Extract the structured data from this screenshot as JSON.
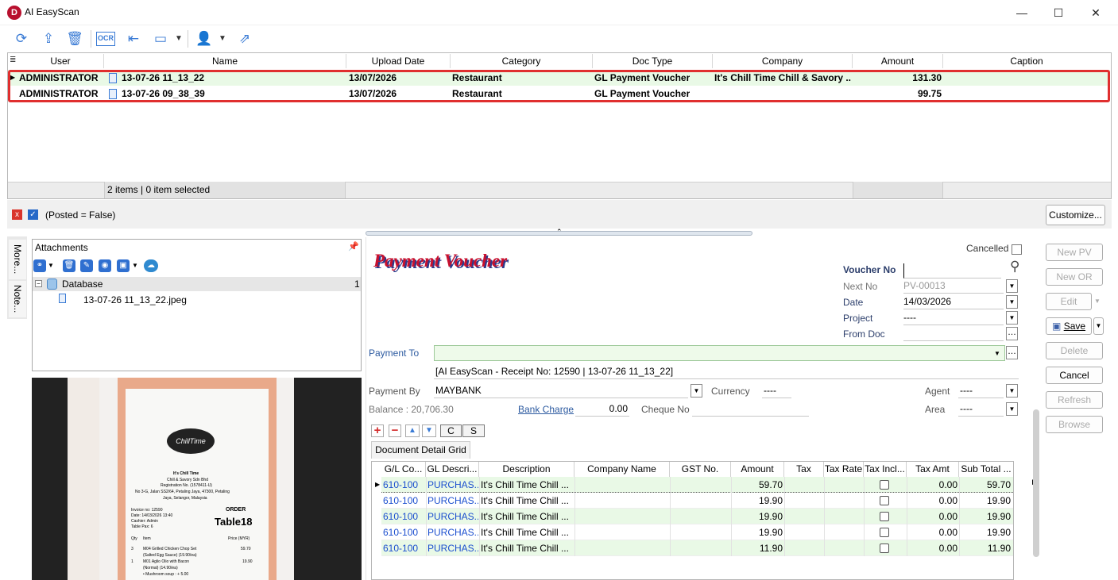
{
  "window": {
    "title": "AI EasyScan",
    "logo_letter": "D",
    "minimize": "—",
    "maximize": "☐",
    "close": "✕"
  },
  "toolbar": [
    "refresh-icon",
    "upload-icon",
    "trash-icon",
    "ocr-icon",
    "collapse-icon",
    "layout-icon",
    "user-icon",
    "share-icon"
  ],
  "toolbar_ocr": "OCR",
  "grid": {
    "columns": [
      "User",
      "Name",
      "Upload Date",
      "Category",
      "Doc Type",
      "Company",
      "Amount",
      "Caption"
    ],
    "rows": [
      {
        "user": "ADMINISTRATOR",
        "name": "13-07-26 11_13_22",
        "date": "13/07/2026",
        "category": "Restaurant",
        "doctype": "GL Payment Voucher",
        "company": "It's Chill Time Chill & Savory ...",
        "amount": "131.30",
        "caption": ""
      },
      {
        "user": "ADMINISTRATOR",
        "name": "13-07-26 09_38_39",
        "date": "13/07/2026",
        "category": "Restaurant",
        "doctype": "GL Payment Voucher",
        "company": "",
        "amount": "99.75",
        "caption": ""
      }
    ],
    "footer": "2 items |  0 item selected"
  },
  "filter": {
    "text": "(Posted = False)",
    "customize": "Customize..."
  },
  "side_tabs": [
    "More...",
    "Note..."
  ],
  "attachments": {
    "title": "Attachments",
    "root": "Database",
    "root_count": "1",
    "file": "13-07-26 11_13_22.jpeg"
  },
  "receipt": {
    "brand": "It's Chill Time",
    "logo": "ChillTime",
    "company": "Chill & Savory Sdn Bhd",
    "reg": "Registration No. (1578411-U)",
    "addr1": "No 3-G, Jalan SS2/64, Petaling Jaya, 47300, Petaling",
    "addr2": "Jaya, Selangor, Malaysia",
    "invoice": "Invoice no: 12590",
    "date": "Date: 14/03/2026 13:40",
    "cashier": "Cashier: Admin",
    "pax": "Table Pax: 6",
    "order": "ORDER",
    "table": "Table18",
    "qty": "Qty",
    "item": "Item",
    "price": "Price (MYR)",
    "l1q": "3",
    "l1": "M04 Grilled Chicken Chop Set",
    "l1p": "59.70",
    "l1b": "(Salted Egg Sauce) (19.90/ea)",
    "l2q": "1",
    "l2": "M01 Aglio Olio with Bacon",
    "l2p": "19.90",
    "l2b": "(Normal) (14.90/ea)",
    "l3": "• Mushroom soup : + 5.00"
  },
  "voucher": {
    "heading": "Payment Voucher",
    "cancelled": "Cancelled",
    "voucher_no_label": "Voucher No",
    "next_no_label": "Next No",
    "next_no": "PV-00013",
    "date_label": "Date",
    "date": "14/03/2026",
    "project_label": "Project",
    "project": "----",
    "fromdoc_label": "From Doc",
    "payto_label": "Payment To",
    "payto_desc": "[AI EasyScan - Receipt No: 12590 | 13-07-26 11_13_22]",
    "payby_label": "Payment By",
    "payby": "MAYBANK",
    "currency_label": "Currency",
    "currency": "----",
    "agent_label": "Agent",
    "agent": "----",
    "balance": "Balance : 20,706.30",
    "bankcharge_label": "Bank Charge",
    "bankcharge": "0.00",
    "cheque_label": "Cheque No",
    "area_label": "Area",
    "area": "----",
    "btn_c": "C",
    "btn_s": "S",
    "detail_tab": "Document Detail Grid"
  },
  "detail": {
    "columns": [
      "G/L Co...",
      "GL Descri...",
      "Description",
      "Company Name",
      "GST No.",
      "Amount",
      "Tax",
      "Tax Rate",
      "Tax Incl...",
      "Tax Amt",
      "Sub Total ..."
    ],
    "rows": [
      {
        "gl": "610-100",
        "gldesc": "PURCHAS...",
        "desc": "It's Chill Time Chill ...",
        "amount": "59.70",
        "taxamt": "0.00",
        "subtotal": "59.70"
      },
      {
        "gl": "610-100",
        "gldesc": "PURCHAS...",
        "desc": "It's Chill Time Chill ...",
        "amount": "19.90",
        "taxamt": "0.00",
        "subtotal": "19.90"
      },
      {
        "gl": "610-100",
        "gldesc": "PURCHAS...",
        "desc": "It's Chill Time Chill ...",
        "amount": "19.90",
        "taxamt": "0.00",
        "subtotal": "19.90"
      },
      {
        "gl": "610-100",
        "gldesc": "PURCHAS...",
        "desc": "It's Chill Time Chill ...",
        "amount": "19.90",
        "taxamt": "0.00",
        "subtotal": "19.90"
      },
      {
        "gl": "610-100",
        "gldesc": "PURCHAS...",
        "desc": "It's Chill Time Chill ...",
        "amount": "11.90",
        "taxamt": "0.00",
        "subtotal": "11.90"
      }
    ]
  },
  "actions": {
    "new_pv": "New PV",
    "new_or": "New OR",
    "edit": "Edit",
    "save": "Save",
    "delete": "Delete",
    "cancel": "Cancel",
    "refresh": "Refresh",
    "browse": "Browse"
  },
  "colors": {
    "accent": "#3a7bd5",
    "row_green": "#e9f9e6",
    "highlight": "#e02f2f",
    "voucher_title": "#c8102e"
  }
}
